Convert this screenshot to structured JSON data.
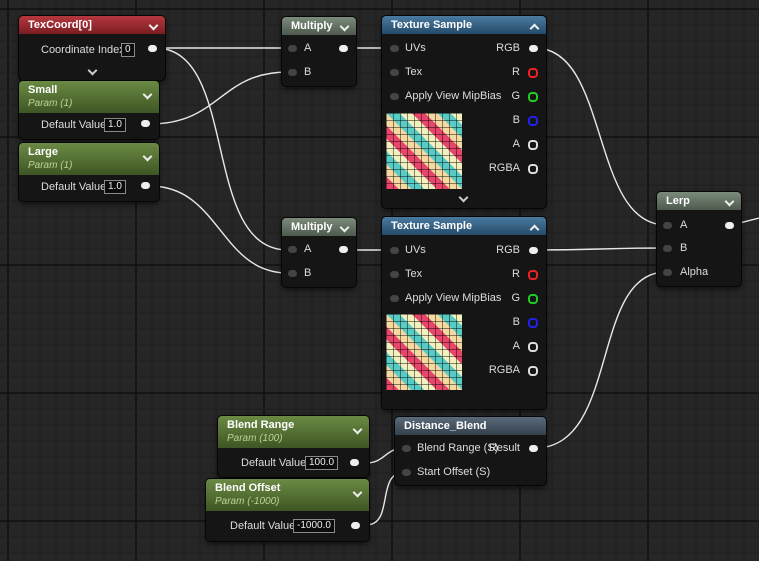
{
  "colors": {
    "background": "#262626",
    "wire": "#e8e8e8",
    "texcoord_header": "#b5383e",
    "param_header": "#6b8a44",
    "texture_header": "#4a7aa0",
    "math_header": "#7b8b7b",
    "function_header": "#5a6a7a"
  },
  "nodes": {
    "texcoord": {
      "title": "TexCoord[0]",
      "pin_label": "Coordinate Index",
      "value": "0"
    },
    "small": {
      "title": "Small",
      "subtitle": "Param (1)",
      "pin_label": "Default Value",
      "value": "1.0"
    },
    "large": {
      "title": "Large",
      "subtitle": "Param (1)",
      "pin_label": "Default Value",
      "value": "1.0"
    },
    "multiply1": {
      "title": "Multiply",
      "pin_a": "A",
      "pin_b": "B"
    },
    "multiply2": {
      "title": "Multiply",
      "pin_a": "A",
      "pin_b": "B"
    },
    "texsample1": {
      "title": "Texture Sample",
      "inputs": [
        "UVs",
        "Tex",
        "Apply View MipBias"
      ],
      "outputs": [
        "RGB",
        "R",
        "G",
        "B",
        "A",
        "RGBA"
      ]
    },
    "texsample2": {
      "title": "Texture Sample",
      "inputs": [
        "UVs",
        "Tex",
        "Apply View MipBias"
      ],
      "outputs": [
        "RGB",
        "R",
        "G",
        "B",
        "A",
        "RGBA"
      ]
    },
    "lerp": {
      "title": "Lerp",
      "pin_a": "A",
      "pin_b": "B",
      "pin_alpha": "Alpha"
    },
    "blend_range": {
      "title": "Blend Range",
      "subtitle": "Param (100)",
      "pin_label": "Default Value",
      "value": "100.0"
    },
    "blend_offset": {
      "title": "Blend Offset",
      "subtitle": "Param (-1000)",
      "pin_label": "Default Value",
      "value": "-1000.0"
    },
    "distance_blend": {
      "title": "Distance_Blend",
      "pin_blend_range": "Blend Range (S)",
      "pin_start_offset": "Start Offset (S)",
      "pin_result": "Result"
    }
  }
}
